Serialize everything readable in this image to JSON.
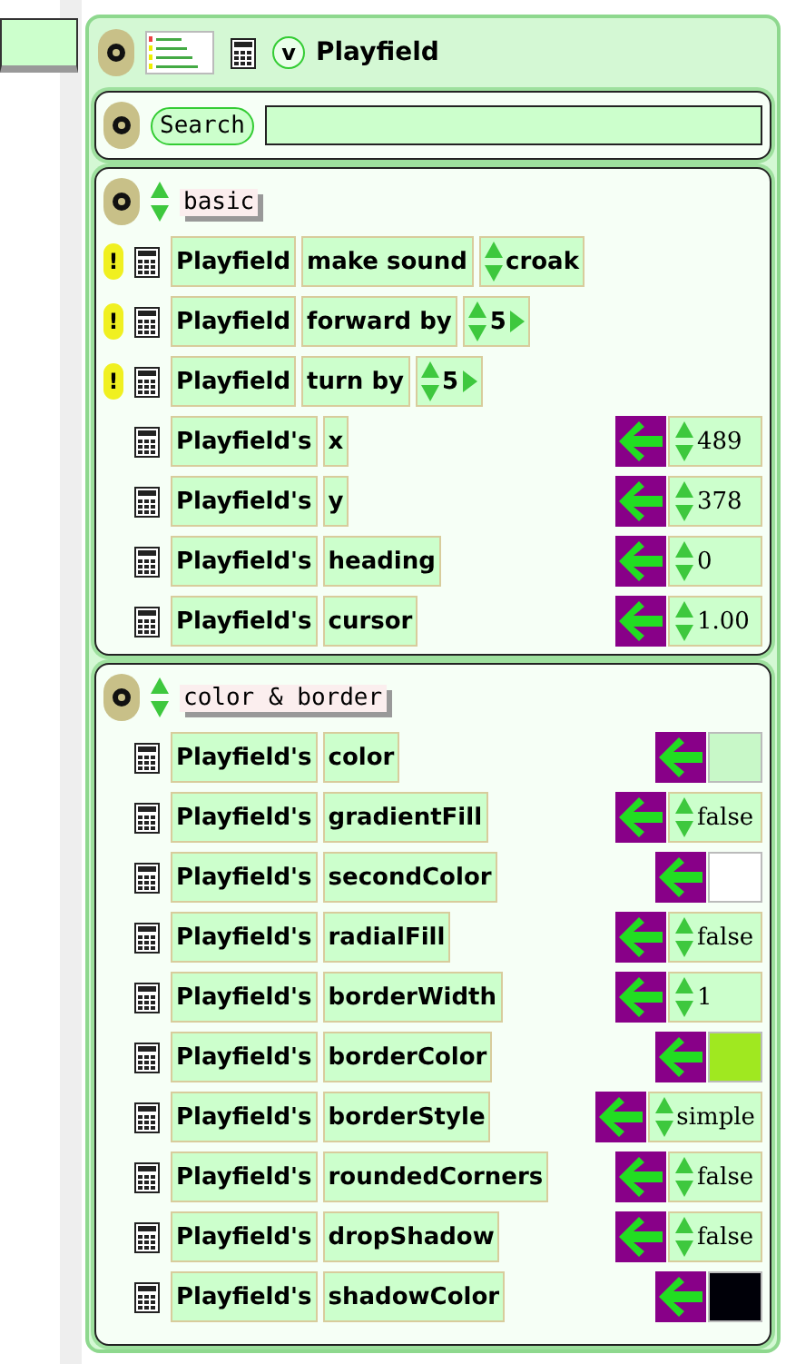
{
  "viewer": {
    "collapse_button": "v",
    "title": "Playfield",
    "search_button": "Search"
  },
  "categories": [
    {
      "name": "basic",
      "rows": [
        {
          "kind": "command",
          "run_button": "!",
          "subject": "Playfield",
          "verb": "make sound",
          "arg": {
            "kind": "choice",
            "text": "croak"
          }
        },
        {
          "kind": "command",
          "run_button": "!",
          "subject": "Playfield",
          "verb": "forward by",
          "arg": {
            "kind": "number",
            "text": "5"
          }
        },
        {
          "kind": "command",
          "run_button": "!",
          "subject": "Playfield",
          "verb": "turn by",
          "arg": {
            "kind": "number",
            "text": "5"
          }
        },
        {
          "kind": "slot",
          "subject": "Playfield's",
          "slot": "x",
          "value": {
            "kind": "text",
            "text": "489"
          }
        },
        {
          "kind": "slot",
          "subject": "Playfield's",
          "slot": "y",
          "value": {
            "kind": "text",
            "text": "378"
          }
        },
        {
          "kind": "slot",
          "subject": "Playfield's",
          "slot": "heading",
          "value": {
            "kind": "text",
            "text": "0"
          }
        },
        {
          "kind": "slot",
          "subject": "Playfield's",
          "slot": "cursor",
          "value": {
            "kind": "text",
            "text": "1.00"
          }
        }
      ]
    },
    {
      "name": "color & border",
      "rows": [
        {
          "kind": "slot",
          "subject": "Playfield's",
          "slot": "color",
          "value": {
            "kind": "color",
            "color": "#c8f8c8"
          }
        },
        {
          "kind": "slot",
          "subject": "Playfield's",
          "slot": "gradientFill",
          "value": {
            "kind": "text",
            "text": "false"
          }
        },
        {
          "kind": "slot",
          "subject": "Playfield's",
          "slot": "secondColor",
          "value": {
            "kind": "color",
            "color": "#ffffff"
          }
        },
        {
          "kind": "slot",
          "subject": "Playfield's",
          "slot": "radialFill",
          "value": {
            "kind": "text",
            "text": "false"
          }
        },
        {
          "kind": "slot",
          "subject": "Playfield's",
          "slot": "borderWidth",
          "value": {
            "kind": "text",
            "text": "1"
          }
        },
        {
          "kind": "slot",
          "subject": "Playfield's",
          "slot": "borderColor",
          "value": {
            "kind": "color",
            "color": "#a0e820"
          }
        },
        {
          "kind": "slot",
          "subject": "Playfield's",
          "slot": "borderStyle",
          "value": {
            "kind": "text",
            "text": "simple"
          }
        },
        {
          "kind": "slot",
          "subject": "Playfield's",
          "slot": "roundedCorners",
          "value": {
            "kind": "text",
            "text": "false"
          }
        },
        {
          "kind": "slot",
          "subject": "Playfield's",
          "slot": "dropShadow",
          "value": {
            "kind": "text",
            "text": "false"
          }
        },
        {
          "kind": "slot",
          "subject": "Playfield's",
          "slot": "shadowColor",
          "value": {
            "kind": "color",
            "color": "#000008"
          }
        }
      ]
    }
  ]
}
